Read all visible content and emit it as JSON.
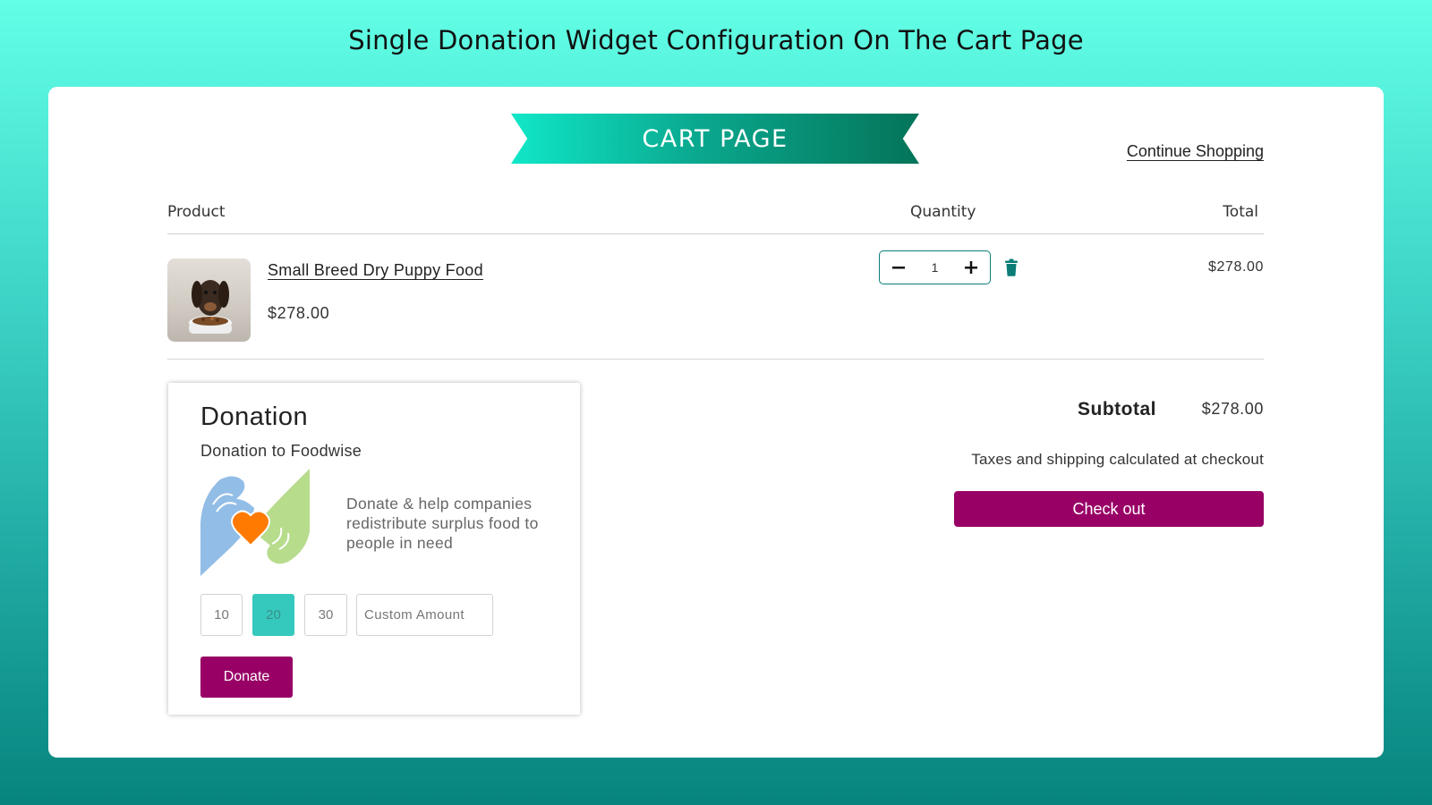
{
  "page_heading": "Single Donation Widget Configuration On The Cart Page",
  "banner": {
    "label": "CART PAGE"
  },
  "continue_shopping": "Continue Shopping",
  "table": {
    "headers": {
      "product": "Product",
      "quantity": "Quantity",
      "total": "Total"
    },
    "rows": [
      {
        "name": "Small Breed Dry Puppy Food",
        "price": "$278.00",
        "quantity": "1",
        "total": "$278.00",
        "image_icon": "puppy-food-image"
      }
    ]
  },
  "donation": {
    "title": "Donation",
    "subtitle": "Donation to Foodwise",
    "description": "Donate & help companies redistribute surplus food to people in need",
    "amounts": [
      "10",
      "20",
      "30"
    ],
    "selected_amount": "20",
    "custom_placeholder": "Custom Amount",
    "button_label": "Donate",
    "logo_icon": "hands-heart-icon"
  },
  "summary": {
    "subtotal_label": "Subtotal",
    "subtotal_value": "$278.00",
    "tax_note": "Taxes and shipping calculated at checkout",
    "checkout_label": "Check out"
  },
  "colors": {
    "accent": "#990066",
    "teal": "#0b7d76",
    "selected_amount": "#35c9bd"
  }
}
